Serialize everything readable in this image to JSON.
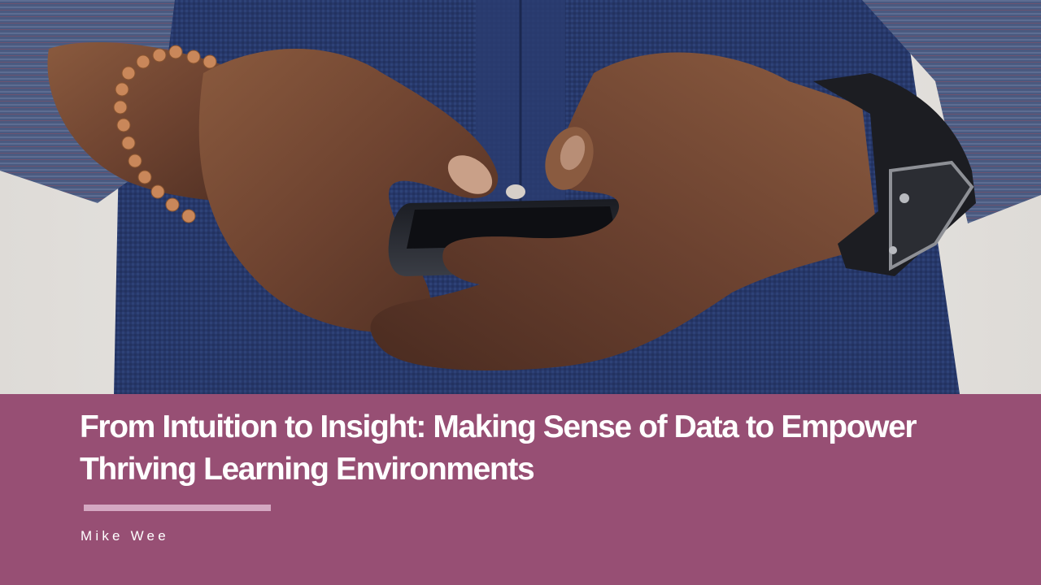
{
  "slide": {
    "title": "From Intuition to Insight: Making Sense of Data to Empower Thriving Learning Environments",
    "author": "Mike Wee"
  },
  "colors": {
    "banner": "#974f74",
    "accent_rule": "#d4a8c2",
    "title_text": "#ffffff"
  },
  "photo": {
    "icon": "hands-holding-smartphone-photo"
  }
}
